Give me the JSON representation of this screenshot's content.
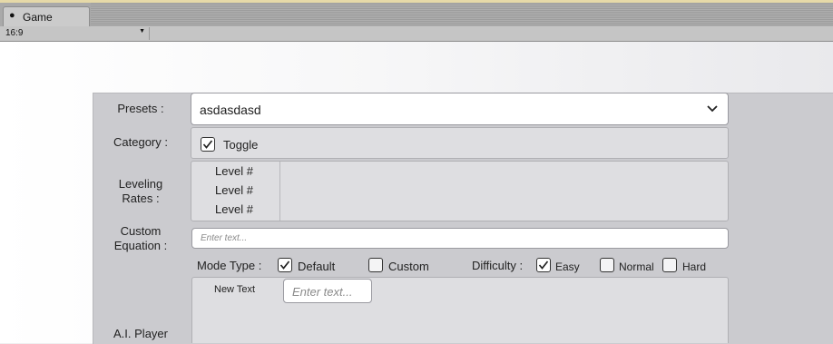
{
  "window": {
    "tab_title": "Game",
    "tab_icon": "unity-icon"
  },
  "toolbar": {
    "aspect": "16:9"
  },
  "presets": {
    "label": "Presets :",
    "value": "asdasdasd"
  },
  "category": {
    "label": "Category :",
    "toggle_label": "Toggle",
    "checked": true
  },
  "leveling": {
    "label_line1": "Leveling",
    "label_line2": "Rates :",
    "items": [
      "Level #",
      "Level #",
      "Level #"
    ]
  },
  "custom_equation": {
    "label_line1": "Custom",
    "label_line2": "Equation :",
    "placeholder": "Enter text..."
  },
  "mode_type": {
    "label": "Mode Type :",
    "options": [
      {
        "label": "Default",
        "checked": true
      },
      {
        "label": "Custom",
        "checked": false
      }
    ]
  },
  "difficulty": {
    "label": "Difficulty :",
    "options": [
      {
        "label": "Easy",
        "checked": true
      },
      {
        "label": "Normal",
        "checked": false
      },
      {
        "label": "Hard",
        "checked": false
      }
    ]
  },
  "ai_player": {
    "label": "A.I. Player",
    "new_text_label": "New Text",
    "placeholder": "Enter text..."
  }
}
